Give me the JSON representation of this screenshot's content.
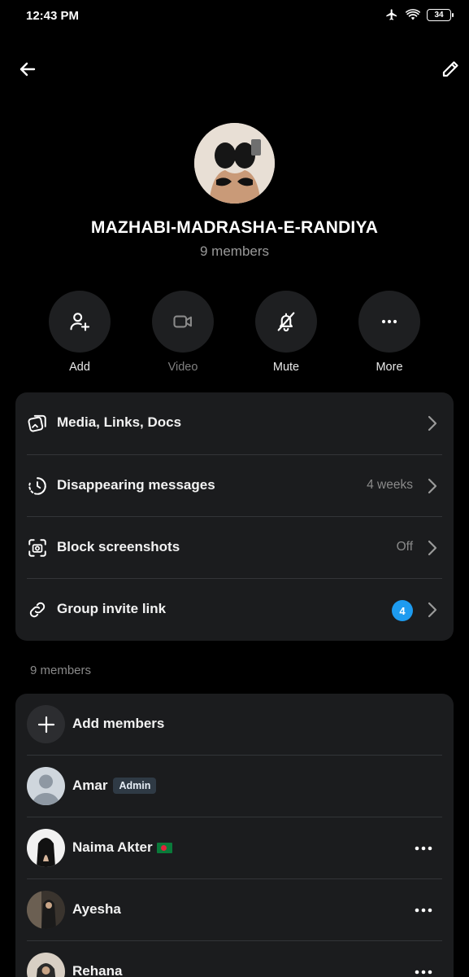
{
  "status_bar": {
    "time": "12:43 PM",
    "battery": "34",
    "icons": [
      "airplane-icon",
      "wifi-icon",
      "battery-icon"
    ]
  },
  "top_bar": {
    "back_icon": "arrow-left-icon",
    "edit_icon": "pencil-icon"
  },
  "group": {
    "name": "MAZHABI-MADRASHA-E-RANDIYA",
    "members_count": "9 members"
  },
  "actions": [
    {
      "label": "Add",
      "icon": "add-person-icon"
    },
    {
      "label": "Video",
      "icon": "video-camera-icon",
      "disabled": true
    },
    {
      "label": "Mute",
      "icon": "bell-off-icon"
    },
    {
      "label": "More",
      "icon": "more-dots-icon"
    }
  ],
  "settings": [
    {
      "label": "Media, Links, Docs",
      "value": "",
      "icon": "media-icon"
    },
    {
      "label": "Disappearing messages",
      "value": "4 weeks",
      "icon": "timer-icon"
    },
    {
      "label": "Block screenshots",
      "value": "Off",
      "icon": "screenshot-icon"
    },
    {
      "label": "Group invite link",
      "badge": "4",
      "icon": "link-icon"
    }
  ],
  "members_section": {
    "title": "9 members",
    "add_members_label": "Add members",
    "members": [
      {
        "name": "Amar",
        "badge": "Admin"
      },
      {
        "name": "Naima Akter",
        "flag": "bangladesh-flag-icon"
      },
      {
        "name": "Ayesha"
      },
      {
        "name": "Rehana"
      }
    ]
  },
  "colors": {
    "background": "#000000",
    "card": "#1b1c1e",
    "accent": "#1d9bf0",
    "muted_text": "#8a8a8a"
  }
}
